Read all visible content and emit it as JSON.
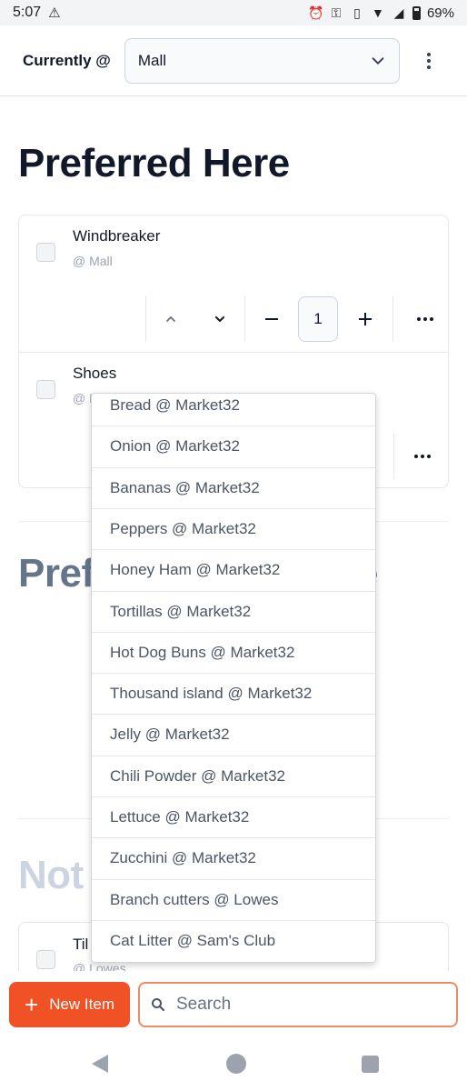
{
  "status_bar": {
    "time": "5:07",
    "battery": "69%",
    "icons": [
      "warning-icon",
      "alarm-icon",
      "key-icon",
      "vibrate-icon",
      "wifi-icon",
      "signal-icon",
      "battery-icon"
    ]
  },
  "header": {
    "label": "Currently @",
    "location_value": "Mall",
    "icons": [
      "chevron-down-icon",
      "kebab-menu-icon"
    ]
  },
  "sections": {
    "preferred_here": "Preferred Here",
    "preferred_elsewhere_partial": "Pref",
    "preferred_elsewhere_tail": "e",
    "not_partial": "Not"
  },
  "preferred_items": [
    {
      "name": "Windbreaker",
      "location": "@ Mall",
      "quantity": "1"
    },
    {
      "name": "Shoes",
      "location": "@ Mall"
    }
  ],
  "not_items": [
    {
      "name_partial": "Til",
      "location": "@ Lowes"
    }
  ],
  "dropdown": {
    "options": [
      "Bread @ Market32",
      "Onion @ Market32",
      "Bananas @ Market32",
      "Peppers @ Market32",
      "Honey Ham @ Market32",
      "Tortillas @ Market32",
      "Hot Dog Buns @ Market32",
      "Thousand island @ Market32",
      "Jelly @ Market32",
      "Chili Powder @ Market32",
      "Lettuce @ Market32",
      "Zucchini @ Market32",
      "Branch cutters @ Lowes",
      "Cat Litter @ Sam's Club"
    ]
  },
  "bottom_bar": {
    "new_item_label": "New Item",
    "search_placeholder": "Search",
    "icons": [
      "plus-icon",
      "search-icon"
    ]
  },
  "colors": {
    "accent": "#f05125",
    "search_border": "#f08a6c",
    "heading": "#111827",
    "muted_heading": "#64748b",
    "faint_heading": "#cbd5e1"
  }
}
